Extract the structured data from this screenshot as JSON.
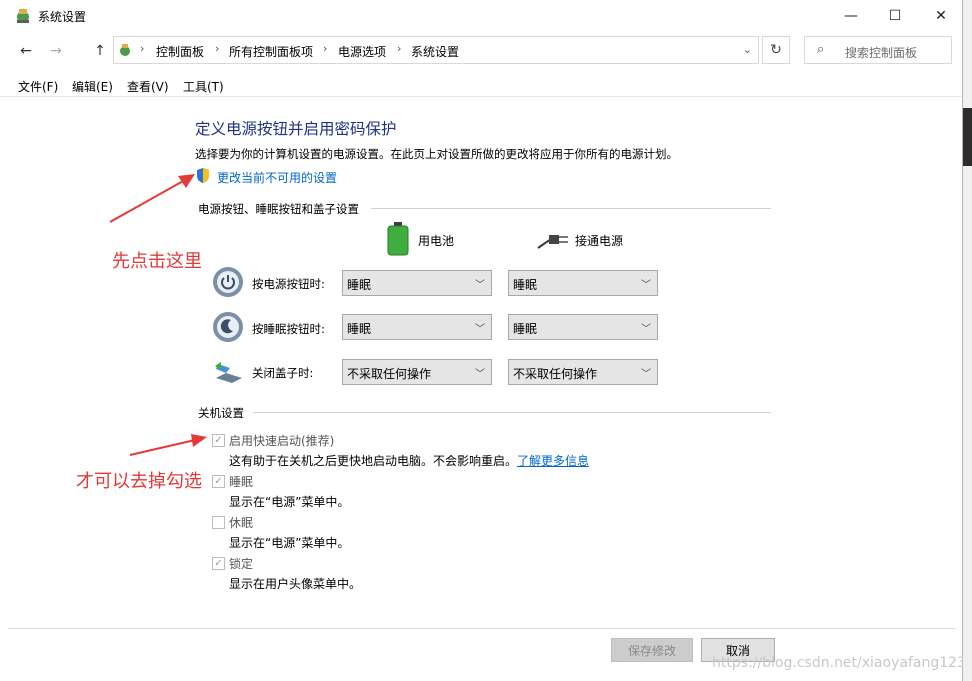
{
  "window": {
    "title": "系统设置"
  },
  "title_controls": {
    "minimize": "—",
    "maximize": "☐",
    "close": "✕"
  },
  "nav": {
    "back": "←",
    "forward": "→",
    "up": "↑"
  },
  "address": {
    "breadcrumbs": [
      "控制面板",
      "所有控制面板项",
      "电源选项",
      "系统设置"
    ],
    "separator": "›",
    "dropdown": "⌄",
    "refresh": "↻"
  },
  "search": {
    "placeholder": "搜索控制面板",
    "icon": "search-icon"
  },
  "menu": [
    "文件(F)",
    "编辑(E)",
    "查看(V)",
    "工具(T)"
  ],
  "content": {
    "heading": "定义电源按钮并启用密码保护",
    "description": "选择要为你的计算机设置的电源设置。在此页上对设置所做的更改将应用于你所有的电源计划。",
    "change_link": "更改当前不可用的设置",
    "power_section": "电源按钮、睡眠按钮和盖子设置",
    "col_battery": "用电池",
    "col_plugged": "接通电源",
    "rows": [
      {
        "label": "按电源按钮时:",
        "battery": "睡眠",
        "plugged": "睡眠"
      },
      {
        "label": "按睡眠按钮时:",
        "battery": "睡眠",
        "plugged": "睡眠"
      },
      {
        "label": "关闭盖子时:",
        "battery": "不采取任何操作",
        "plugged": "不采取任何操作"
      }
    ],
    "shutdown_section": "关机设置",
    "options": [
      {
        "label": "启用快速启动(推荐)",
        "checked": true,
        "desc": "这有助于在关机之后更快地启动电脑。不会影响重启。",
        "link": "了解更多信息"
      },
      {
        "label": "睡眠",
        "checked": true,
        "desc": "显示在“电源”菜单中。"
      },
      {
        "label": "休眠",
        "checked": false,
        "desc": "显示在“电源”菜单中。"
      },
      {
        "label": "锁定",
        "checked": true,
        "desc": "显示在用户头像菜单中。"
      }
    ]
  },
  "buttons": {
    "save": "保存修改",
    "cancel": "取消"
  },
  "annotations": {
    "first": "先点击这里",
    "second": "才可以去掉勾选"
  },
  "watermark": "https://blog.csdn.net/xiaoyafang123",
  "colors": {
    "heading": "#1e3287",
    "link": "#0066cc",
    "annotation": "#e53935"
  }
}
